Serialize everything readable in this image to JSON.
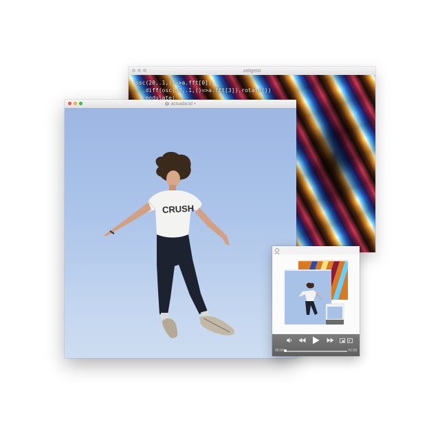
{
  "windows": {
    "zeitgeist": {
      "title": "zeitgeist",
      "code_lines": [
        "osc(20,.1,()=>a.fft[0])",
        "  .diff(osc(30,.1,()=>a.fft[3]).rotate())",
        "  .modulate("
      ]
    },
    "actualacid": {
      "title": "actualacid",
      "title_icon": "person-icon"
    },
    "player": {
      "controls": {
        "volume_icon": "speaker-icon",
        "rewind_icon": "rewind-icon",
        "play_icon": "play-icon",
        "forward_icon": "fast-forward-icon",
        "pip_icon": "picture-in-picture-icon",
        "fullscreen_icon": "fullscreen-icon"
      },
      "time_elapsed": "00:00",
      "time_total": "01:58",
      "progress": 0.0
    }
  },
  "colors": {
    "close": "#fc605b",
    "minimize": "#fdbc40",
    "zoom": "#34c84a",
    "sky_top": "#9db7e3",
    "sky_bottom": "#cdddf1"
  }
}
